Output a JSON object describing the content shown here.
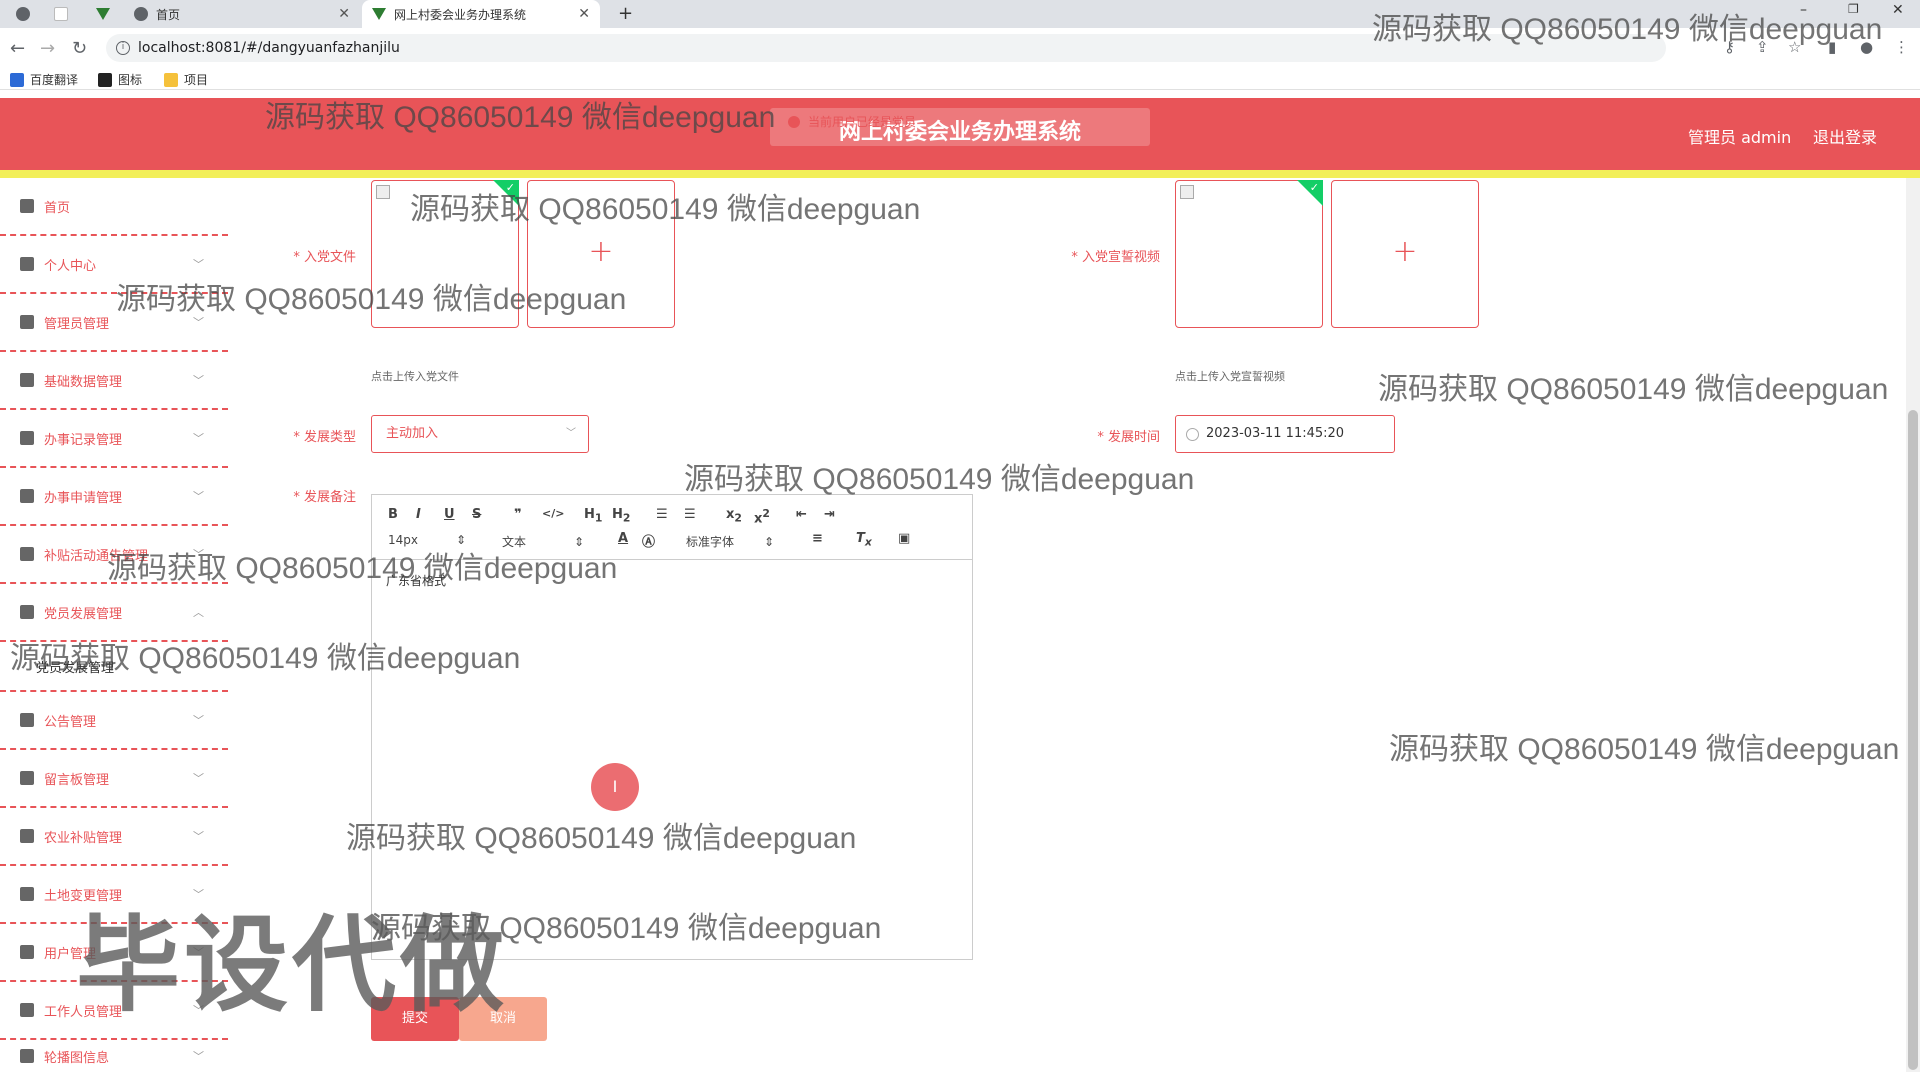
{
  "browser": {
    "tabs": [
      {
        "label": ""
      },
      {
        "label": "首页"
      },
      {
        "label": "网上村委会业务办理系统"
      }
    ],
    "url": "localhost:8081/#/dangyuanfazhanjilu",
    "bookmarks": [
      "百度翻译",
      "图标",
      "项目"
    ]
  },
  "header": {
    "system_title": "网上村委会业务办理系统",
    "toast": "当前用户已经是党员",
    "admin_label": "管理员 admin",
    "logout": "退出登录"
  },
  "sidebar": {
    "items": [
      {
        "label": "首页",
        "icon": "home-icon"
      },
      {
        "label": "个人中心",
        "icon": "user-icon"
      },
      {
        "label": "管理员管理",
        "icon": "admin-icon"
      },
      {
        "label": "基础数据管理",
        "icon": "grid-icon"
      },
      {
        "label": "办事记录管理",
        "icon": "mail-icon"
      },
      {
        "label": "办事申请管理",
        "icon": "phone-icon"
      },
      {
        "label": "补贴活动通告管理",
        "icon": "clipboard-icon"
      },
      {
        "label": "党员发展管理",
        "icon": "monitor-icon"
      },
      {
        "label": "公告管理",
        "icon": "chat-icon"
      },
      {
        "label": "留言板管理",
        "icon": "bell-icon"
      },
      {
        "label": "农业补贴管理",
        "icon": "clipboard-icon"
      },
      {
        "label": "土地变更管理",
        "icon": "settings-icon"
      },
      {
        "label": "用户管理",
        "icon": "clipboard-icon"
      },
      {
        "label": "工作人员管理",
        "icon": "film-icon"
      },
      {
        "label": "轮播图信息",
        "icon": "flag-icon"
      }
    ],
    "submenu": {
      "label": "党员发展管理"
    }
  },
  "form": {
    "party_file_label": "入党文件",
    "party_file_tip": "点击上传入党文件",
    "oath_video_label": "入党宣誓视频",
    "oath_video_tip": "点击上传入党宣誓视频",
    "dev_type_label": "发展类型",
    "dev_type_value": "主动加入",
    "dev_time_label": "发展时间",
    "dev_time_value": "2023-03-11 11:45:20",
    "dev_note_label": "发展备注",
    "editor": {
      "font_size": "14px",
      "paragraph": "文本",
      "font_family": "标准字体",
      "content": "广东省格式"
    },
    "submit": "提交",
    "cancel": "取消"
  },
  "watermark": {
    "text": "源码获取 QQ86050149 微信deepguan",
    "big": "毕设代做"
  },
  "colors": {
    "brand": "#e85458",
    "header_strip": "#f2ef5a",
    "cancel": "#f7a78e",
    "success": "#13ce66"
  }
}
